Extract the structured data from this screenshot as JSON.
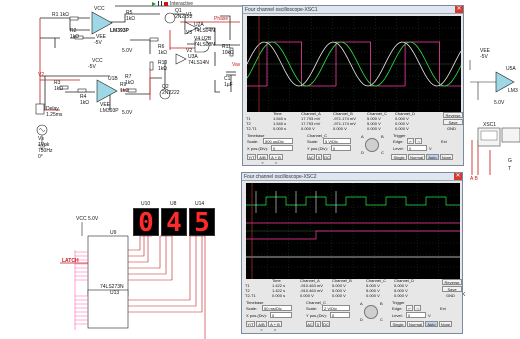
{
  "toolbar": {
    "interactive_label": "Interactive",
    "play_icon": "play-icon",
    "pause_icon": "pause-icon",
    "stop_icon": "stop-icon"
  },
  "colors": {
    "wire_red": "#c21a1a",
    "wire_dark": "#222222",
    "opamp_fill": "#9ed7e6",
    "bus_pink": "#ff5fb4",
    "trace_green": "#2ee64a",
    "trace_pink": "#ff3da8",
    "trace_white": "#e8e8e8",
    "display_red": "#ff2a2a"
  },
  "schematic": {
    "labels": {
      "r1": "R1",
      "r1v": "1kΩ",
      "r2": "R2",
      "r2v": "1kΩ",
      "r3": "R3",
      "r3v": "1kΩ",
      "r4": "R4",
      "r4v": "1kΩ",
      "r5": "R5",
      "r5v": "1kΩ",
      "r6": "R6",
      "r6v": "1kΩ",
      "r9": "R9",
      "r9v": "1kΩ",
      "r10": "R10",
      "r10v": "1kΩ",
      "r11": "R11",
      "r11v": "10kΩ",
      "r7": "R7",
      "r7v": "1kΩ",
      "u1a": "U1A",
      "u1b": "U1B",
      "lm1": "LM393P",
      "lm2": "LM393P",
      "vcc1": "VCC",
      "vcc2": "VCC",
      "vee1": "VEE",
      "vee2": "VEE",
      "m5v1": "-5V",
      "m5v2": "-5V",
      "p5v1": "5.0V",
      "p5v2": "5.0V",
      "q1": "Q1",
      "q1p": "2N2222",
      "q2": "Q2",
      "q2p": "2N2222",
      "u2a": "U2A",
      "u2ap": "74LS04N",
      "u2b": "U2B",
      "u2bp": "74LS08N",
      "u3a": "U3A",
      "u3ap": "74LS14N",
      "v1": "V1",
      "v2": "V2",
      "v3": "V3",
      "v4": "V4",
      "phase": "Phase",
      "c1": "C1",
      "c1v": "1µF",
      "vav": "Vav",
      "vs": "Vs",
      "vsv": "1Vpk",
      "vsf": "750Hz",
      "vsd": "0°",
      "delay": "Delay",
      "delayv": "1.25ms",
      "vcc3": "VCC",
      "vcc3v": "5.0V",
      "u9": "U9",
      "u9p": "74LS273N",
      "latch": "LATCH",
      "u13": "U13",
      "u10": "U10",
      "u8": "U8",
      "u14": "U14",
      "vee_r": "VEE",
      "vee_r2": "-5V",
      "u5a": "U5A",
      "lm_r": "LM3",
      "p5_r": "5.0V",
      "xsc1": "XSC1",
      "ab": "A B",
      "g": "G",
      "t": "T",
      "k": "K"
    },
    "display_digits": [
      "0",
      "4",
      "5"
    ]
  },
  "scope1": {
    "title": "Four channel oscilloscope-XSC1",
    "close": "✕",
    "table_headers": [
      "Time",
      "Channel_A",
      "Channel_B",
      "Channel_C",
      "Channel_D"
    ],
    "rows": [
      {
        "name": "T1",
        "time": "1.540 s",
        "a": "17.793 mV",
        "b": "-971.174 mV",
        "c": "5.000 V",
        "d": "0.000 V"
      },
      {
        "name": "T2",
        "time": "1.540 s",
        "a": "17.793 mV",
        "b": "-971.174 mV",
        "c": "5.000 V",
        "d": "0.000 V"
      },
      {
        "name": "T2-T1",
        "time": "0.000 s",
        "a": "0.000 V",
        "b": "0.000 V",
        "c": "0.000 V",
        "d": "0.000 V"
      }
    ],
    "reverse": "Reverse",
    "save": "Save",
    "gnd": "GND",
    "timebase": "Timebase",
    "channel_c": "Channel_C",
    "trigger": "Trigger",
    "scale_label": "Scale:",
    "scale_value": "500 us/Div",
    "ch_scale_label": "Scale:",
    "ch_scale_value": "5 V/Div",
    "xpos_label": "X pos.(Div):",
    "xpos_value": "0",
    "ypos_label": "Y pos.(Div):",
    "ypos_value": "0",
    "edge_label": "Edge:",
    "level_label": "Level:",
    "level_value": "0",
    "level_unit": "V",
    "ext_label": "Ext",
    "mode_buttons": [
      "Y/T",
      "A/B >",
      "A + B >"
    ],
    "coupling_buttons": [
      "AC",
      "0",
      "DC"
    ],
    "sweep_buttons": [
      "Single",
      "Normal",
      "Auto",
      "None"
    ],
    "channel_knob": [
      "A",
      "B",
      "C",
      "D"
    ]
  },
  "scope2": {
    "title": "Four channel oscilloscope-XSC2",
    "close": "✕",
    "table_headers": [
      "Time",
      "Channel_A",
      "Channel_B",
      "Channel_C",
      "Channel_D"
    ],
    "rows": [
      {
        "name": "T1",
        "time": "1.422 s",
        "a": "-910.463 mV",
        "b": "5.000 V",
        "c": "5.000 V",
        "d": "5.000 V"
      },
      {
        "name": "T2",
        "time": "1.422 s",
        "a": "-910.463 mV",
        "b": "5.000 V",
        "c": "5.000 V",
        "d": "5.000 V"
      },
      {
        "name": "T2-T1",
        "time": "0.000 s",
        "a": "0.000 V",
        "b": "0.000 V",
        "c": "0.000 V",
        "d": "0.000 V"
      }
    ],
    "reverse": "Reverse",
    "save": "Save",
    "gnd": "GND",
    "timebase": "Timebase",
    "channel_c": "Channel_C",
    "trigger": "Trigger",
    "scale_label": "Scale:",
    "scale_value": "50 ms/Div",
    "ch_scale_label": "Scale:",
    "ch_scale_value": "2 V/Div",
    "xpos_label": "X pos.(Div):",
    "xpos_value": "0",
    "ypos_label": "Y pos.(Div):",
    "ypos_value": "0",
    "edge_label": "Edge:",
    "level_label": "Level:",
    "level_value": "0",
    "level_unit": "V",
    "ext_label": "Ext",
    "mode_buttons": [
      "Y/T",
      "A/B >",
      "A + B >"
    ],
    "coupling_buttons": [
      "AC",
      "0",
      "DC"
    ],
    "sweep_buttons": [
      "Single",
      "Normal",
      "Auto",
      "None"
    ],
    "channel_knob": [
      "A",
      "B",
      "C",
      "D"
    ]
  }
}
